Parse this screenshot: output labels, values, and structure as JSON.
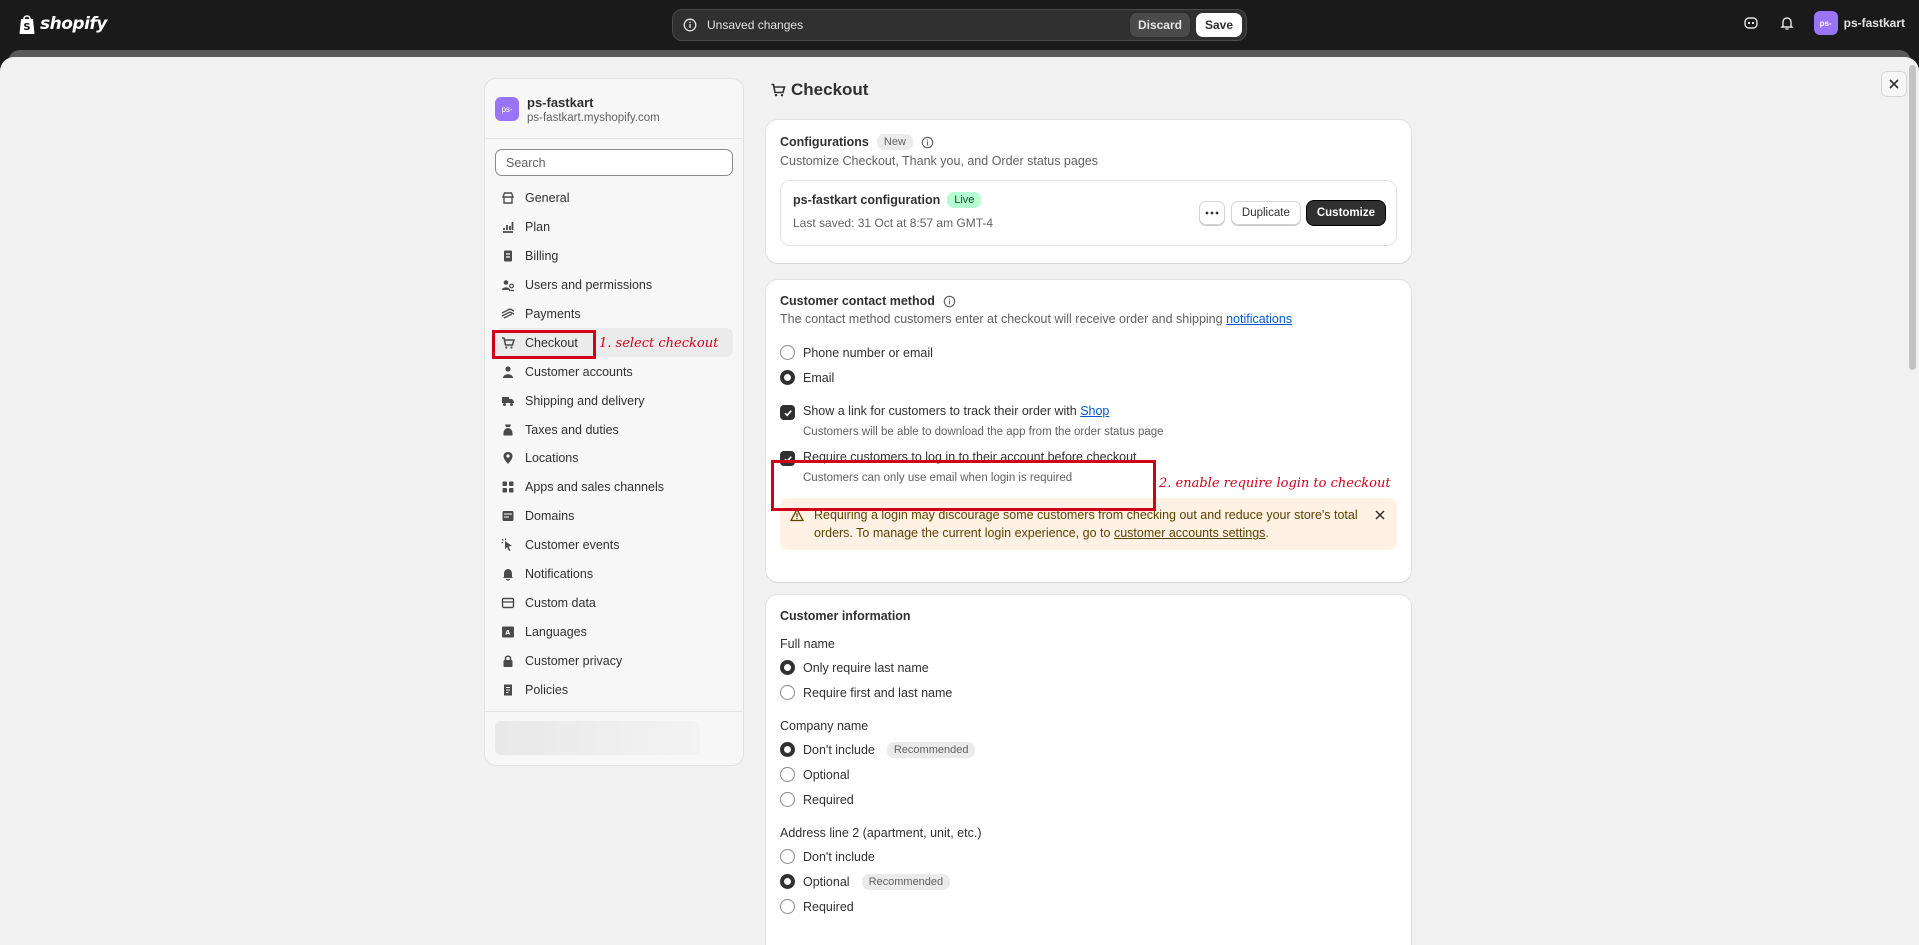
{
  "topbar": {
    "brand": "shopify",
    "unsaved_message": "Unsaved changes",
    "discard_label": "Discard",
    "save_label": "Save",
    "store_avatar": "ps-",
    "store_name": "ps-fastkart",
    "icons": [
      "shopify-bag-icon",
      "info-icon",
      "sidekick-icon",
      "bell-icon"
    ]
  },
  "nav": {
    "avatar": "ps-",
    "store_name": "ps-fastkart",
    "store_url": "ps-fastkart.myshopify.com",
    "search_placeholder": "Search",
    "items": [
      {
        "label": "General",
        "icon": "store-icon"
      },
      {
        "label": "Plan",
        "icon": "plan-chart-icon"
      },
      {
        "label": "Billing",
        "icon": "billing-icon"
      },
      {
        "label": "Users and permissions",
        "icon": "users-icon"
      },
      {
        "label": "Payments",
        "icon": "payments-icon"
      },
      {
        "label": "Checkout",
        "icon": "cart-icon",
        "active": true
      },
      {
        "label": "Customer accounts",
        "icon": "person-icon"
      },
      {
        "label": "Shipping and delivery",
        "icon": "truck-icon"
      },
      {
        "label": "Taxes and duties",
        "icon": "tax-bag-icon"
      },
      {
        "label": "Locations",
        "icon": "location-pin-icon"
      },
      {
        "label": "Apps and sales channels",
        "icon": "apps-icon"
      },
      {
        "label": "Domains",
        "icon": "globe-icon"
      },
      {
        "label": "Customer events",
        "icon": "cursor-icon"
      },
      {
        "label": "Notifications",
        "icon": "bell-icon"
      },
      {
        "label": "Custom data",
        "icon": "database-icon"
      },
      {
        "label": "Languages",
        "icon": "language-icon"
      },
      {
        "label": "Customer privacy",
        "icon": "lock-icon"
      },
      {
        "label": "Policies",
        "icon": "policy-icon"
      }
    ]
  },
  "main": {
    "title": "Checkout",
    "configurations": {
      "title": "Configurations",
      "badge": "New",
      "subtitle": "Customize Checkout, Thank you, and Order status pages",
      "config_name": "ps-fastkart configuration",
      "config_status": "Live",
      "last_saved": "Last saved: 31 Oct at 8:57 am GMT-4",
      "duplicate_label": "Duplicate",
      "customize_label": "Customize"
    },
    "contact": {
      "title": "Customer contact method",
      "subtitle_prefix": "The contact method customers enter at checkout will receive order and shipping ",
      "subtitle_link": "notifications",
      "options": [
        {
          "label": "Phone number or email",
          "selected": false
        },
        {
          "label": "Email",
          "selected": true
        }
      ],
      "shop_link_label_prefix": "Show a link for customers to track their order with ",
      "shop_link_label_link": "Shop",
      "shop_link_help": "Customers will be able to download the app from the order status page",
      "shop_link_checked": true,
      "require_login_label": "Require customers to log in to their account before checkout",
      "require_login_help": "Customers can only use email when login is required",
      "require_login_checked": true,
      "banner_prefix": "Requiring a login may discourage some customers from checking out and reduce your store's total orders. To manage the current login experience, go to ",
      "banner_link": "customer accounts settings",
      "banner_suffix": "."
    },
    "customer_info": {
      "title": "Customer information",
      "full_name": {
        "label": "Full name",
        "options": [
          {
            "label": "Only require last name",
            "selected": true
          },
          {
            "label": "Require first and last name",
            "selected": false
          }
        ]
      },
      "company_name": {
        "label": "Company name",
        "options": [
          {
            "label": "Don't include",
            "selected": true,
            "badge": "Recommended"
          },
          {
            "label": "Optional",
            "selected": false
          },
          {
            "label": "Required",
            "selected": false
          }
        ]
      },
      "address_line2": {
        "label": "Address line 2 (apartment, unit, etc.)",
        "options": [
          {
            "label": "Don't include",
            "selected": false
          },
          {
            "label": "Optional",
            "selected": true,
            "badge": "Recommended"
          },
          {
            "label": "Required",
            "selected": false
          }
        ]
      }
    }
  },
  "annotations": {
    "step1": "1. select checkout",
    "step2": "2. enable require login to checkout",
    "color": "#d0021b"
  }
}
